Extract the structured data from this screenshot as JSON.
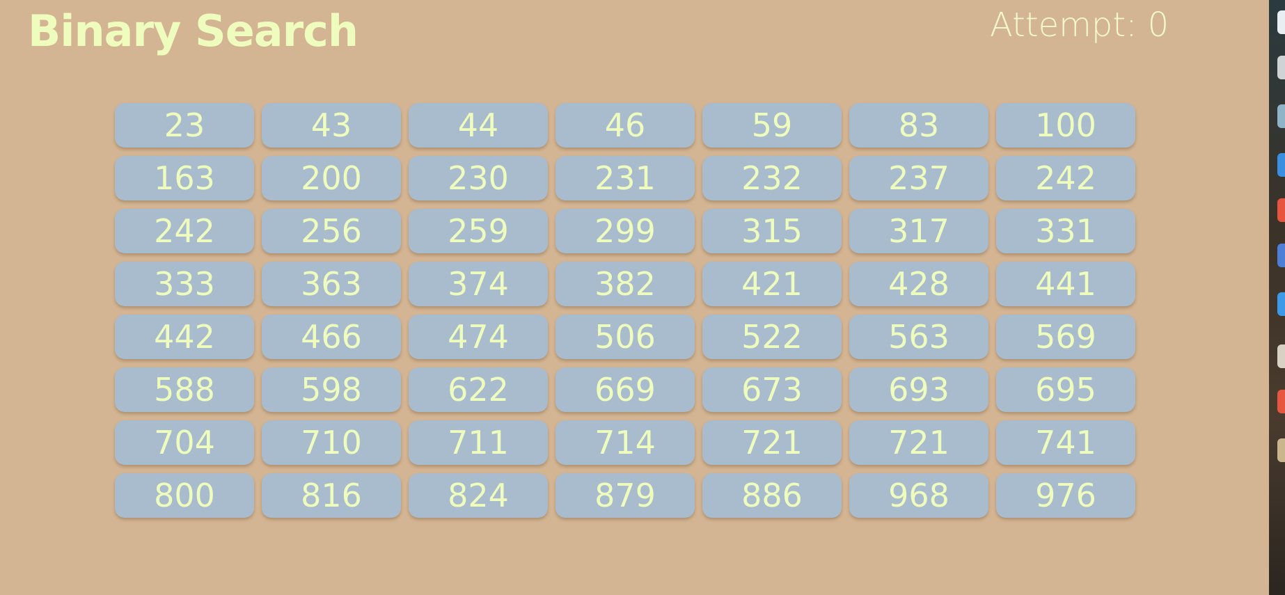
{
  "app": {
    "title": "Binary Search",
    "attempt_text": "Attempt: 0",
    "colors": {
      "background": "#d4b593",
      "tile": "#a8bccd",
      "text": "#eefcbe"
    }
  },
  "grid": {
    "columns": 7,
    "cells": [
      "23",
      "43",
      "44",
      "46",
      "59",
      "83",
      "100",
      "163",
      "200",
      "230",
      "231",
      "232",
      "237",
      "242",
      "242",
      "256",
      "259",
      "299",
      "315",
      "317",
      "331",
      "333",
      "363",
      "374",
      "382",
      "421",
      "428",
      "441",
      "442",
      "466",
      "474",
      "506",
      "522",
      "563",
      "569",
      "588",
      "598",
      "622",
      "669",
      "673",
      "693",
      "695",
      "704",
      "710",
      "711",
      "714",
      "721",
      "721",
      "741",
      "800",
      "816",
      "824",
      "879",
      "886",
      "968",
      "976"
    ]
  },
  "dock_icons": [
    {
      "name": "app-icon",
      "color": "#e9eef2"
    },
    {
      "name": "app-icon",
      "color": "#cfd3d6"
    },
    {
      "name": "app-icon",
      "color": "#8fb3c7"
    },
    {
      "name": "app-icon",
      "color": "#3b8fe0"
    },
    {
      "name": "app-icon",
      "color": "#e8553e"
    },
    {
      "name": "app-icon",
      "color": "#4d7fd6"
    },
    {
      "name": "app-icon",
      "color": "#3d9ae8"
    },
    {
      "name": "app-icon",
      "color": "#d9d2c4"
    },
    {
      "name": "app-icon",
      "color": "#e7573f"
    },
    {
      "name": "app-icon",
      "color": "#c9b68c"
    }
  ]
}
